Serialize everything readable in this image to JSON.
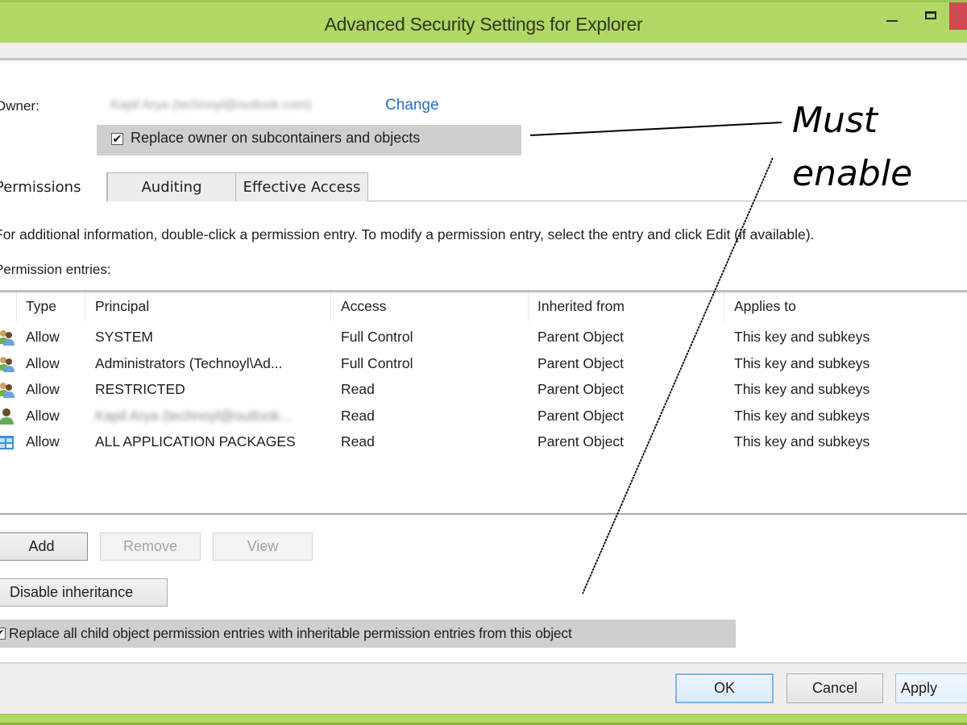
{
  "window": {
    "title": "Advanced Security Settings for Explorer",
    "controls": [
      "minimize",
      "maximize",
      "close"
    ],
    "accent_color": "#b1d765",
    "close_color": "#cc4b4f"
  },
  "owner": {
    "label": "Owner:",
    "value": "Kapil Arya (technoyl@outlook.com)",
    "change_link": "Change",
    "replace_owner_checkbox": {
      "label": "Replace owner on subcontainers and objects",
      "checked": true
    }
  },
  "tabs": [
    {
      "label": "Permissions",
      "active": true
    },
    {
      "label": "Auditing",
      "active": false
    },
    {
      "label": "Effective Access",
      "active": false
    }
  ],
  "info_text": "For additional information, double-click a permission entry. To modify a permission entry, select the entry and click Edit (if available).",
  "entries_label": "Permission entries:",
  "table": {
    "columns": [
      "Type",
      "Principal",
      "Access",
      "Inherited from",
      "Applies to"
    ],
    "rows": [
      {
        "icon": "users-group-icon",
        "type": "Allow",
        "principal": "SYSTEM",
        "access": "Full Control",
        "inherited_from": "Parent Object",
        "applies_to": "This key and subkeys"
      },
      {
        "icon": "users-group-icon",
        "type": "Allow",
        "principal": "Administrators (Technoyl\\Ad...",
        "access": "Full Control",
        "inherited_from": "Parent Object",
        "applies_to": "This key and subkeys"
      },
      {
        "icon": "users-group-icon",
        "type": "Allow",
        "principal": "RESTRICTED",
        "access": "Read",
        "inherited_from": "Parent Object",
        "applies_to": "This key and subkeys"
      },
      {
        "icon": "user-icon",
        "type": "Allow",
        "principal": "Kapil Arya (technoyl@outlook...",
        "access": "Read",
        "inherited_from": "Parent Object",
        "applies_to": "This key and subkeys"
      },
      {
        "icon": "app-packages-icon",
        "type": "Allow",
        "principal": "ALL APPLICATION PACKAGES",
        "access": "Read",
        "inherited_from": "Parent Object",
        "applies_to": "This key and subkeys"
      }
    ]
  },
  "buttons": {
    "add": "Add",
    "remove": "Remove",
    "view": "View",
    "disable_inheritance": "Disable inheritance",
    "ok": "OK",
    "cancel": "Cancel",
    "apply": "Apply"
  },
  "replace_child_checkbox": {
    "label": "Replace all child object permission entries with inheritable permission entries from this object",
    "checked": true
  },
  "annotation": {
    "line1": "Must",
    "line2": "enable"
  }
}
